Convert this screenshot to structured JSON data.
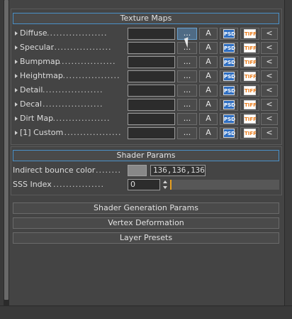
{
  "texture_maps": {
    "header": "Texture Maps",
    "dots": "...................",
    "browse_label": "...",
    "a_label": "A",
    "psd_label": "PSD",
    "tiff_label": "TIFF",
    "back_label": "<",
    "rows": [
      {
        "label": "Diffuse",
        "value": ""
      },
      {
        "label": "Specular",
        "value": ""
      },
      {
        "label": "Bumpmap",
        "value": ""
      },
      {
        "label": "Heightmap",
        "value": ""
      },
      {
        "label": "Detail",
        "value": ""
      },
      {
        "label": "Decal",
        "value": ""
      },
      {
        "label": "Dirt Map",
        "value": ""
      },
      {
        "label": "[1] Custom",
        "value": ""
      }
    ]
  },
  "shader_params": {
    "header": "Shader Params",
    "indirect_bounce": {
      "label": "Indirect bounce color",
      "dots": "........",
      "value": "136,136,136",
      "swatch_color": "#888888"
    },
    "sss_index": {
      "label": "SSS Index",
      "dots": "................",
      "value": "0",
      "fill_fraction": 0.01
    }
  },
  "collapsed_sections": [
    {
      "label": "Shader Generation Params"
    },
    {
      "label": "Vertex Deformation"
    },
    {
      "label": "Layer Presets"
    }
  ],
  "colors": {
    "accent": "#4a90c8",
    "slider_fill": "#e8a020"
  }
}
